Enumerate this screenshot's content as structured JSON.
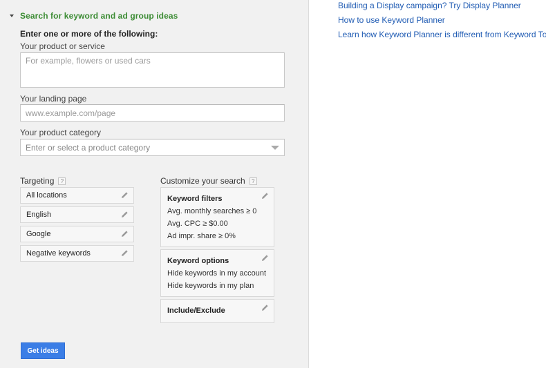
{
  "search": {
    "section_title": "Search for keyword and ad group ideas",
    "instructions": "Enter one or more of the following:",
    "product_label": "Your product or service",
    "product_placeholder": "For example, flowers or used cars",
    "landing_label": "Your landing page",
    "landing_placeholder": "www.example.com/page",
    "category_label": "Your product category",
    "category_placeholder": "Enter or select a product category"
  },
  "targeting": {
    "label": "Targeting",
    "help": "?",
    "items": [
      {
        "label": "All locations",
        "icon": "pencil-icon"
      },
      {
        "label": "English",
        "icon": "pencil-icon"
      },
      {
        "label": "Google",
        "icon": "pencil-icon"
      },
      {
        "label": "Negative keywords",
        "icon": "pencil-icon"
      }
    ]
  },
  "customize": {
    "label": "Customize your search",
    "help": "?",
    "keyword_filters": {
      "title": "Keyword filters",
      "lines": [
        "Avg. monthly searches ≥ 0",
        "Avg. CPC ≥ $0.00",
        "Ad impr. share ≥ 0%"
      ]
    },
    "keyword_options": {
      "title": "Keyword options",
      "lines": [
        "Hide keywords in my account",
        "Hide keywords in my plan"
      ]
    },
    "include_exclude": {
      "title": "Include/Exclude"
    }
  },
  "actions": {
    "get_ideas": "Get ideas"
  },
  "links": [
    "Building a Display campaign? Try Display Planner",
    "How to use Keyword Planner",
    "Learn how Keyword Planner is different from Keyword Tool"
  ],
  "colors": {
    "section_title": "#3c8c34",
    "link": "#1f5bb3",
    "button": "#3b7ee6",
    "panel_bg": "#f1f1f1"
  }
}
